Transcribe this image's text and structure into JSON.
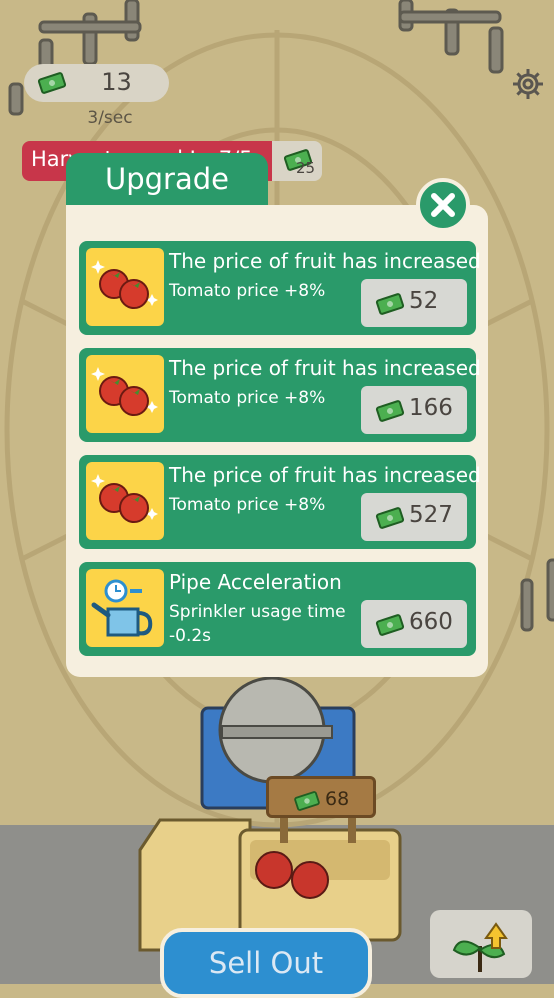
{
  "hud": {
    "money": "13",
    "rate": "3/sec",
    "harvest_label": "Harvest speed Lv.7/5",
    "harvest_cost": "25"
  },
  "dialog": {
    "title": "Upgrade",
    "cards": [
      {
        "title": "The price of fruit has increased",
        "desc": "Tomato price +8%",
        "price": "52",
        "icon": "tomatoes-icon"
      },
      {
        "title": "The price of fruit has increased",
        "desc": "Tomato price +8%",
        "price": "166",
        "icon": "tomatoes-icon"
      },
      {
        "title": "The price of fruit has increased",
        "desc": "Tomato price +8%",
        "price": "527",
        "icon": "tomatoes-icon"
      },
      {
        "title": "Pipe Acceleration",
        "desc": "Sprinkler usage time -0.2s",
        "price": "660",
        "icon": "watering-can-icon"
      }
    ]
  },
  "truck": {
    "sign_price": "68"
  },
  "bottom": {
    "sell_label": "Sell Out"
  },
  "colors": {
    "panel_green": "#2a9a6a",
    "panel_bg": "#f6efdf",
    "icon_yellow": "#fcd448",
    "sell_blue": "#2d8fd0",
    "harvest_red": "#c8364a"
  }
}
